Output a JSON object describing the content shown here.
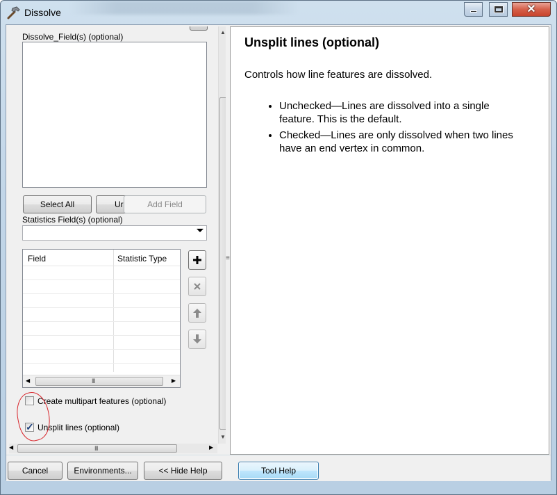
{
  "window": {
    "title": "Dissolve",
    "icon": "hammer-icon",
    "minimize_icon": "minimize-icon",
    "maximize_icon": "maximize-icon",
    "close_icon": "close-icon"
  },
  "params": {
    "dissolve_fields_label": "Dissolve_Field(s) (optional)",
    "dissolve_fields_items": [],
    "select_all_label": "Select All",
    "unselect_all_label": "Ur",
    "add_field_label": "Add Field",
    "statistics_label": "Statistics Field(s) (optional)",
    "statistics_value": "",
    "grid": {
      "columns": [
        "Field",
        "Statistic Type"
      ],
      "rows": []
    },
    "grid_hscroll_grip": "III",
    "multipart_label": "Create multipart features (optional)",
    "multipart_checked": false,
    "unsplit_label": "Unsplit lines (optional)",
    "unsplit_checked": true,
    "left_hscroll_grip": "III",
    "splitter_grip": "≡"
  },
  "help": {
    "title": "Unsplit lines (optional)",
    "description": "Controls how line features are dissolved.",
    "bullets": [
      "Unchecked—Lines are dissolved into a single feature. This is the default.",
      "Checked—Lines are only dissolved when two lines have an end vertex in common."
    ]
  },
  "buttons": {
    "cancel": "Cancel",
    "environments": "Environments...",
    "hide_help": "<< Hide Help",
    "tool_help": "Tool Help"
  },
  "colors": {
    "annotation": "#d8242a",
    "checkmark": "#1c3f7a"
  }
}
